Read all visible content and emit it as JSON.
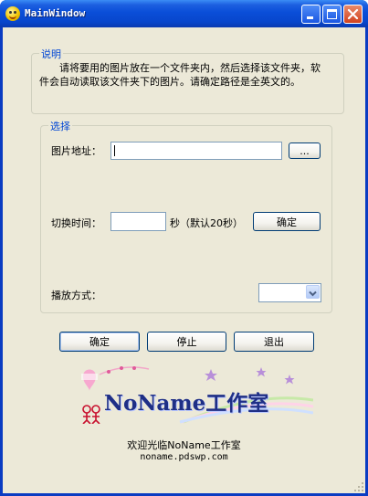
{
  "window": {
    "title": "MainWindow",
    "controls": {
      "minimize": "minimize",
      "maximize": "maximize",
      "close": "close"
    }
  },
  "instructions": {
    "group_title": "说明",
    "text": "请将要用的图片放在一个文件夹内，然后选择该文件夹，软件会自动读取该文件夹下的图片。请确定路径是全英文的。"
  },
  "selection": {
    "group_title": "选择",
    "image_path_label": "图片地址：",
    "image_path_value": "",
    "browse_button": "...",
    "interval_label": "切换时间：",
    "interval_value": "",
    "interval_unit": "秒（默认20秒）",
    "interval_confirm_button": "确定",
    "play_mode_label": "播放方式：",
    "play_mode_value": ""
  },
  "actions": {
    "ok_button": "确定",
    "stop_button": "停止",
    "exit_button": "退出"
  },
  "branding": {
    "logo_text": "NoName工作室",
    "welcome_text": "欢迎光临NoName工作室",
    "url_text": "noname.pdswp.com"
  },
  "colors": {
    "titlebar": "#0a4ed8",
    "client_bg": "#ece9d8",
    "group_title": "#0046d5",
    "logo_text": "#1f2f86"
  }
}
